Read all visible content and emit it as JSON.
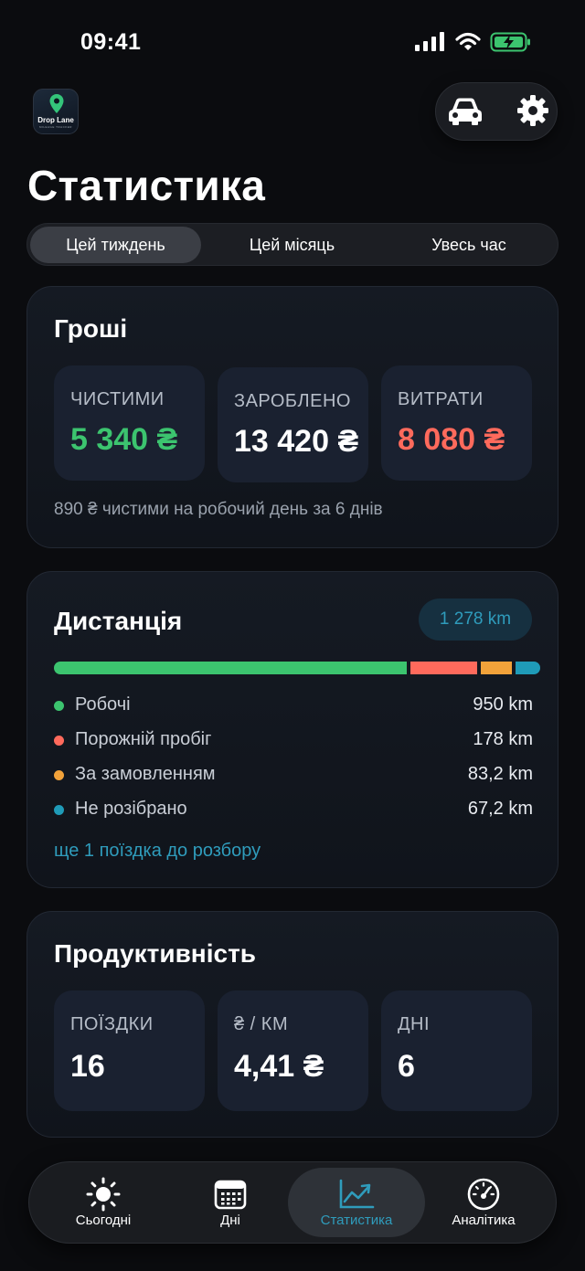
{
  "status_bar": {
    "time": "09:41"
  },
  "app": {
    "logo_name": "Drop Lane",
    "logo_tagline": "MILEAGE TRACKER"
  },
  "header": {
    "title": "Статистика",
    "icons": [
      "car-icon",
      "gear-icon"
    ]
  },
  "period_tabs": [
    {
      "label": "Цей тиждень",
      "active": true
    },
    {
      "label": "Цей місяць",
      "active": false
    },
    {
      "label": "Увесь час",
      "active": false
    }
  ],
  "money": {
    "title": "Гроші",
    "tiles": [
      {
        "label": "ЧИСТИМИ",
        "value": "5 340 ₴",
        "color": "#3cc46f"
      },
      {
        "label": "ЗАРОБЛЕНО",
        "value": "13 420 ₴",
        "color": "#ffffff"
      },
      {
        "label": "ВИТРАТИ",
        "value": "8 080 ₴",
        "color": "#ff6a5c"
      }
    ],
    "note": "890 ₴ чистими на робочий день за 6 днів"
  },
  "distance": {
    "title": "Дистанція",
    "total": "1 278 km",
    "segments": [
      {
        "label": "Робочі",
        "value": "950 km",
        "km": 950,
        "color": "#3cc46f"
      },
      {
        "label": "Порожній пробіг",
        "value": "178 km",
        "km": 178,
        "color": "#ff6a5c"
      },
      {
        "label": "За замовленням",
        "value": "83,2 km",
        "km": 83.2,
        "color": "#f2a23a"
      },
      {
        "label": "Не розібрано",
        "value": "67,2 km",
        "km": 67.2,
        "color": "#1f9bb8"
      }
    ],
    "link": "ще 1 поїздка до розбору"
  },
  "productivity": {
    "title": "Продуктивність",
    "tiles": [
      {
        "label": "ПОЇЗДКИ",
        "value": "16"
      },
      {
        "label": "₴ / КМ",
        "value": "4,41 ₴"
      },
      {
        "label": "ДНІ",
        "value": "6"
      }
    ]
  },
  "tabbar": [
    {
      "label": "Сьогодні",
      "icon": "sun-icon",
      "active": false
    },
    {
      "label": "Дні",
      "icon": "calendar-icon",
      "active": false
    },
    {
      "label": "Статистика",
      "icon": "chart-icon",
      "active": true
    },
    {
      "label": "Аналітика",
      "icon": "gauge-icon",
      "active": false
    }
  ],
  "colors": {
    "accent": "#2f9cbc",
    "positive": "#3cc46f",
    "negative": "#ff6a5c",
    "background": "#0b0c0f"
  }
}
